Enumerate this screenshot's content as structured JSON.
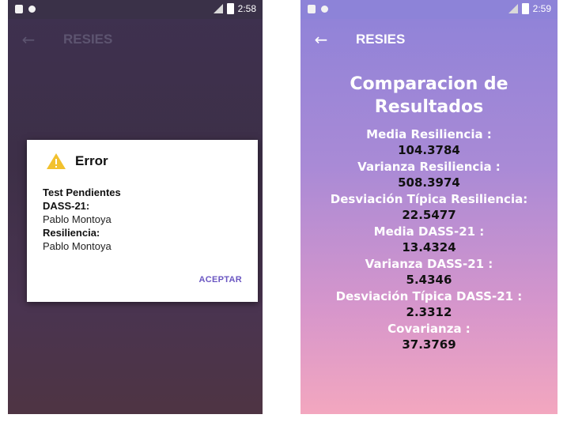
{
  "status": {
    "time_left": "2:58",
    "time_right": "2:59"
  },
  "app_title": "RESIES",
  "dialog": {
    "title": "Error",
    "line1": "Test Pendientes",
    "line2": "DASS-21:",
    "line3": "Pablo Montoya",
    "line4": "Resiliencia:",
    "line5": "Pablo Montoya",
    "button": "ACEPTAR"
  },
  "results": {
    "title_line1": "Comparacion de",
    "title_line2": "Resultados",
    "items": [
      {
        "label": "Media Resiliencia :",
        "value": "104.3784"
      },
      {
        "label": "Varianza Resiliencia :",
        "value": "508.3974"
      },
      {
        "label": "Desviación Típica Resiliencia:",
        "value": "22.5477"
      },
      {
        "label": "Media DASS-21 :",
        "value": "13.4324"
      },
      {
        "label": "Varianza DASS-21 :",
        "value": "5.4346"
      },
      {
        "label": "Desviación Típica DASS-21 :",
        "value": "2.3312"
      },
      {
        "label": "Covarianza :",
        "value": "37.3769"
      }
    ]
  },
  "colors": {
    "accent": "#6b57c2",
    "warning": "#f2c12e"
  }
}
